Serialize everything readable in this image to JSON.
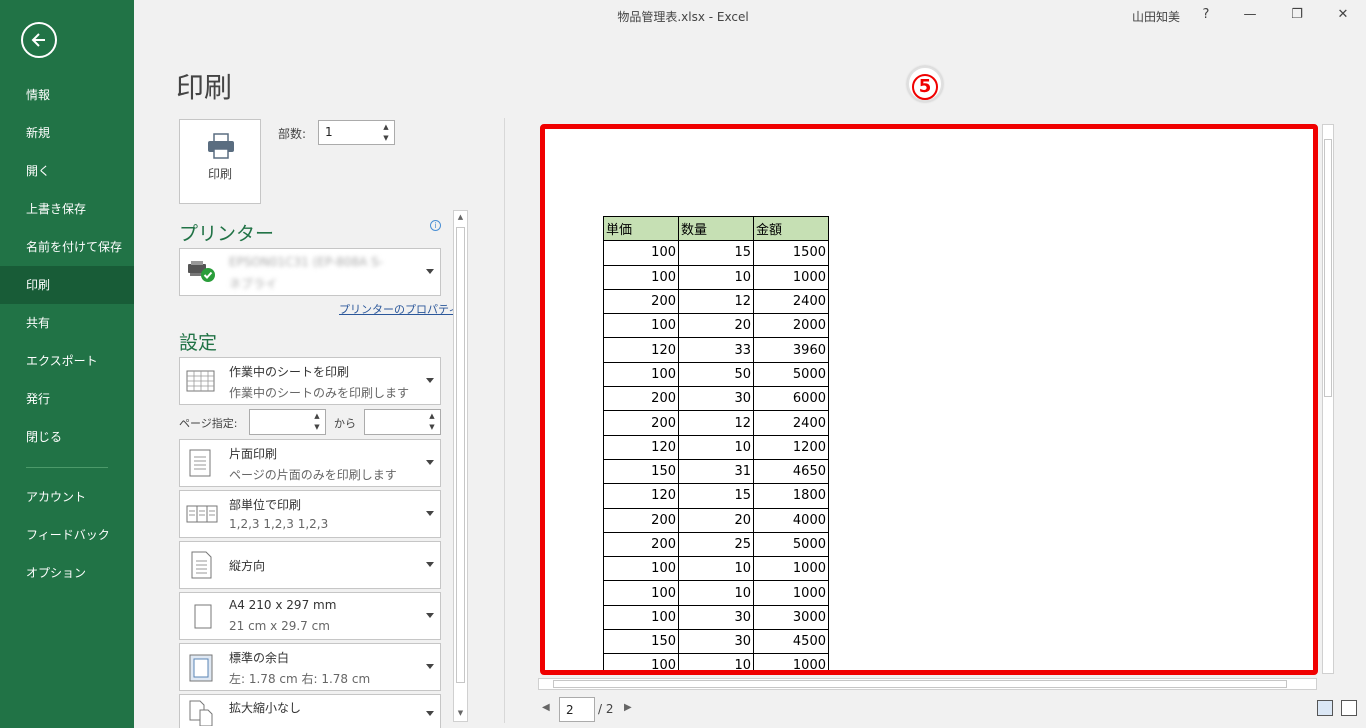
{
  "window": {
    "title": "物品管理表.xlsx  -  Excel",
    "user": "山田知美",
    "help": "?",
    "minimize": "—",
    "restore": "❐",
    "close": "✕"
  },
  "sidebar": {
    "items": [
      {
        "label": "情報"
      },
      {
        "label": "新規"
      },
      {
        "label": "開く"
      },
      {
        "label": "上書き保存"
      },
      {
        "label": "名前を付けて保存"
      },
      {
        "label": "印刷"
      },
      {
        "label": "共有"
      },
      {
        "label": "エクスポート"
      },
      {
        "label": "発行"
      },
      {
        "label": "閉じる"
      },
      {
        "label": "アカウント"
      },
      {
        "label": "フィードバック"
      },
      {
        "label": "オプション"
      }
    ],
    "active": "印刷",
    "accent": "#217346"
  },
  "print": {
    "page_title": "印刷",
    "button_label": "印刷",
    "copies_label": "部数:",
    "copies_value": "1",
    "printer_section": "プリンター",
    "printer_name": "EPSON01C31 (EP-808A S-",
    "printer_status": "ネブライ",
    "printer_properties": "プリンターのプロパティ",
    "settings_section": "設定",
    "pages_label": "ページ指定:",
    "pages_to": "から"
  },
  "settings": [
    {
      "main": "作業中のシートを印刷",
      "sub": "作業中のシートのみを印刷します",
      "icon": "sheet-icon"
    },
    {
      "main": "片面印刷",
      "sub": "ページの片面のみを印刷します",
      "icon": "one-sided-icon"
    },
    {
      "main": "部単位で印刷",
      "sub": "1,2,3    1,2,3    1,2,3",
      "icon": "collated-icon"
    },
    {
      "main": "縦方向",
      "sub": "",
      "icon": "portrait-icon"
    },
    {
      "main": "A4 210 x 297 mm",
      "sub": "21 cm x 29.7 cm",
      "icon": "paper-size-icon"
    },
    {
      "main": "標準の余白",
      "sub": "左:  1.78 cm     右:  1.78 cm",
      "icon": "margins-icon"
    },
    {
      "main": "拡大縮小なし",
      "sub": "",
      "icon": "scaling-icon"
    }
  ],
  "preview": {
    "step_badge": "5",
    "frame_color": "#f00000",
    "table": {
      "headers": [
        "単価",
        "数量",
        "金額"
      ],
      "rows": [
        [
          "100",
          "15",
          "1500"
        ],
        [
          "100",
          "10",
          "1000"
        ],
        [
          "200",
          "12",
          "2400"
        ],
        [
          "100",
          "20",
          "2000"
        ],
        [
          "120",
          "33",
          "3960"
        ],
        [
          "100",
          "50",
          "5000"
        ],
        [
          "200",
          "30",
          "6000"
        ],
        [
          "200",
          "12",
          "2400"
        ],
        [
          "120",
          "10",
          "1200"
        ],
        [
          "150",
          "31",
          "4650"
        ],
        [
          "120",
          "15",
          "1800"
        ],
        [
          "200",
          "20",
          "4000"
        ],
        [
          "200",
          "25",
          "5000"
        ],
        [
          "100",
          "10",
          "1000"
        ],
        [
          "100",
          "10",
          "1000"
        ],
        [
          "100",
          "30",
          "3000"
        ],
        [
          "150",
          "30",
          "4500"
        ],
        [
          "100",
          "10",
          "1000"
        ]
      ]
    }
  },
  "page_nav": {
    "current": "2",
    "total": "/ 2"
  }
}
